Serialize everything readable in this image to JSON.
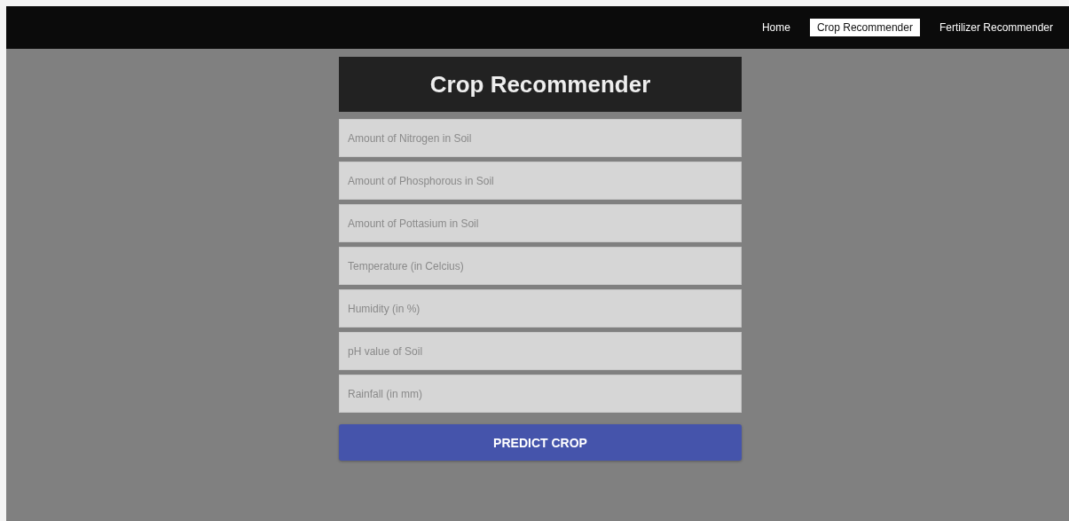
{
  "nav": [
    {
      "label": "Home",
      "selected": false
    },
    {
      "label": "Crop Recommender",
      "selected": true
    },
    {
      "label": "Fertilizer Recommender",
      "selected": false
    }
  ],
  "form": {
    "title": "Crop Recommender",
    "fields": [
      {
        "placeholder": "Amount of Nitrogen in Soil"
      },
      {
        "placeholder": "Amount of Phosphorous in Soil"
      },
      {
        "placeholder": "Amount of Pottasium in Soil"
      },
      {
        "placeholder": "Temperature (in Celcius)"
      },
      {
        "placeholder": "Humidity (in %)"
      },
      {
        "placeholder": "pH value of Soil"
      },
      {
        "placeholder": "Rainfall (in mm)"
      }
    ],
    "button": "PREDICT CROP"
  }
}
